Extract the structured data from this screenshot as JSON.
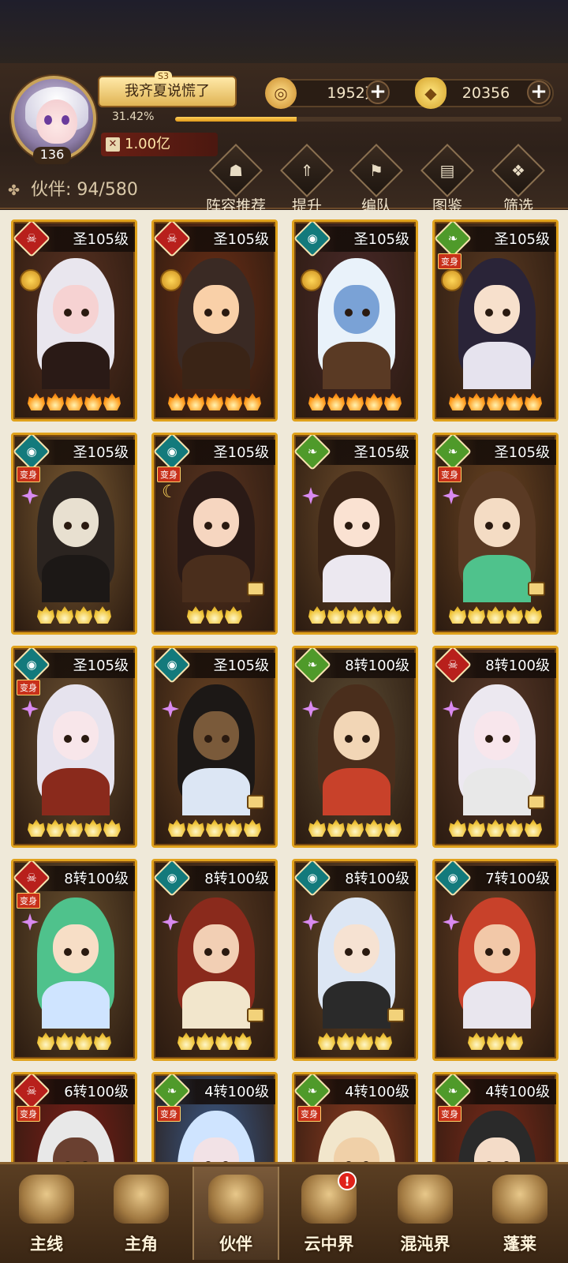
{
  "player": {
    "name": "我齐夏说慌了",
    "season": "S3",
    "level": "136",
    "exp_percent": "31.42%",
    "exp_fraction": 0.3142,
    "power": "1.00亿"
  },
  "currencies": {
    "coins": "1952万",
    "ingots": "20356"
  },
  "partners": {
    "label": "伙伴",
    "count": "94/580"
  },
  "toolbar": [
    {
      "label": "阵容推荐",
      "icon": "lineup-recommend-icon"
    },
    {
      "label": "提升",
      "icon": "upgrade-icon"
    },
    {
      "label": "编队",
      "icon": "formation-icon"
    },
    {
      "label": "图鉴",
      "icon": "codex-icon"
    },
    {
      "label": "筛选",
      "icon": "filter-icon"
    }
  ],
  "heroes": [
    {
      "level": "圣105级",
      "element": "red",
      "transform": false,
      "flames": 5,
      "badge": "medal"
    },
    {
      "level": "圣105级",
      "element": "red",
      "transform": false,
      "flames": 5,
      "badge": "medal"
    },
    {
      "level": "圣105级",
      "element": "teal",
      "transform": false,
      "flames": 5,
      "badge": "medal"
    },
    {
      "level": "圣105级",
      "element": "green",
      "transform": true,
      "flames": 5,
      "badge": "medal"
    },
    {
      "level": "圣105级",
      "element": "teal",
      "transform": true,
      "flames": 4,
      "badge": "star"
    },
    {
      "level": "圣105级",
      "element": "teal",
      "transform": true,
      "flames": 3,
      "badge": "moon"
    },
    {
      "level": "圣105级",
      "element": "green",
      "transform": false,
      "flames": 5,
      "badge": "star"
    },
    {
      "level": "圣105级",
      "element": "green",
      "transform": true,
      "flames": 5,
      "badge": "star"
    },
    {
      "level": "圣105级",
      "element": "teal",
      "transform": true,
      "flames": 5,
      "badge": "star"
    },
    {
      "level": "圣105级",
      "element": "teal",
      "transform": false,
      "flames": 5,
      "badge": "star"
    },
    {
      "level": "8转100级",
      "element": "green",
      "transform": false,
      "flames": 5,
      "badge": "star"
    },
    {
      "level": "8转100级",
      "element": "red",
      "transform": false,
      "flames": 5,
      "badge": "star"
    },
    {
      "level": "8转100级",
      "element": "red",
      "transform": true,
      "flames": 4,
      "badge": "star"
    },
    {
      "level": "8转100级",
      "element": "teal",
      "transform": false,
      "flames": 4,
      "badge": "star"
    },
    {
      "level": "8转100级",
      "element": "teal",
      "transform": false,
      "flames": 4,
      "badge": "star"
    },
    {
      "level": "7转100级",
      "element": "teal",
      "transform": false,
      "flames": 3,
      "badge": "star"
    },
    {
      "level": "6转100级",
      "element": "red",
      "transform": true,
      "flames": 0,
      "badge": "none"
    },
    {
      "level": "4转100级",
      "element": "green",
      "transform": true,
      "flames": 0,
      "badge": "none"
    },
    {
      "level": "4转100级",
      "element": "green",
      "transform": true,
      "flames": 0,
      "badge": "none"
    },
    {
      "level": "4转100级",
      "element": "green",
      "transform": true,
      "flames": 0,
      "badge": "none"
    }
  ],
  "transform_label": "变身",
  "bottom_nav": [
    {
      "label": "主线",
      "icon": "main-quest-icon",
      "active": false,
      "alert": ""
    },
    {
      "label": "主角",
      "icon": "protagonist-icon",
      "active": false,
      "alert": ""
    },
    {
      "label": "伙伴",
      "icon": "partner-icon",
      "active": true,
      "alert": ""
    },
    {
      "label": "云中界",
      "icon": "cloud-realm-icon",
      "active": false,
      "alert": "!"
    },
    {
      "label": "混沌界",
      "icon": "chaos-realm-icon",
      "active": false,
      "alert": ""
    },
    {
      "label": "蓬莱",
      "icon": "penglai-icon",
      "active": false,
      "alert": ""
    }
  ],
  "colors": {
    "card_border": "#e0a21c",
    "element_red": "#b8201c",
    "element_teal": "#137a7c",
    "element_green": "#4f9a2a"
  }
}
